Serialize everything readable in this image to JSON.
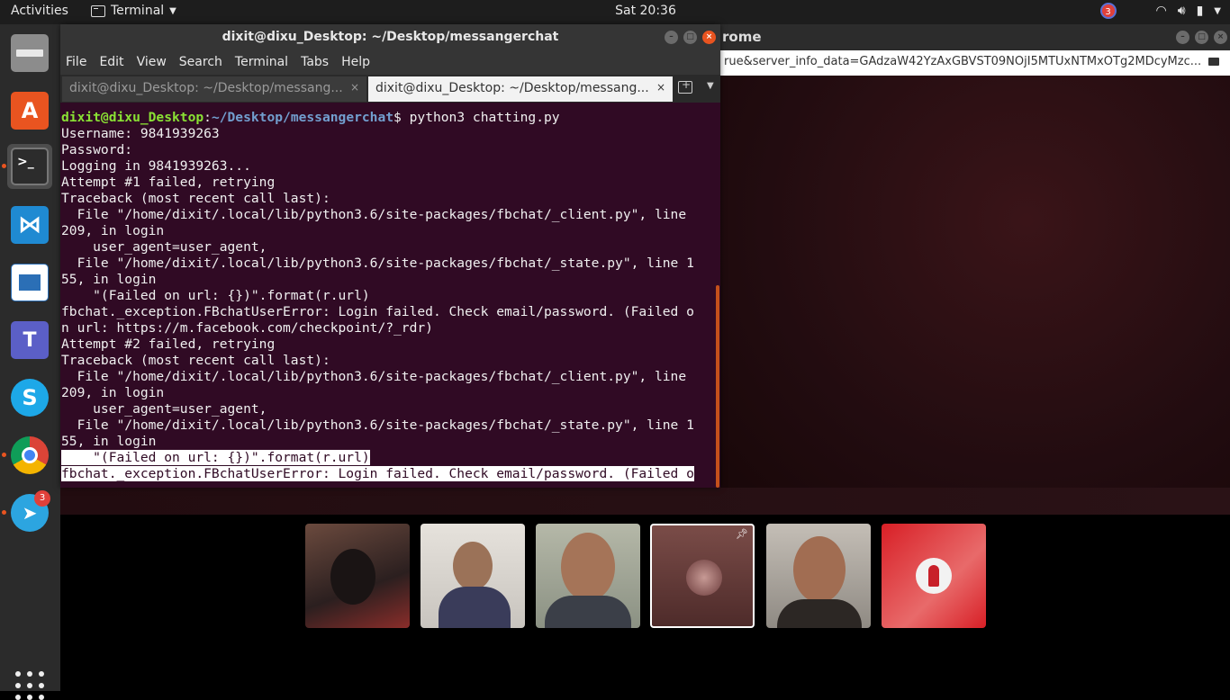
{
  "topbar": {
    "activities": "Activities",
    "app_name": "Terminal",
    "clock": "Sat 20:36",
    "notification_count": "3"
  },
  "dock": {
    "items": [
      {
        "name": "files",
        "color": "#8c8c8c"
      },
      {
        "name": "software",
        "color": "#e95420"
      },
      {
        "name": "terminal",
        "color": "#2c2c2c",
        "active": true
      },
      {
        "name": "vscode",
        "color": "#1f8ad2"
      },
      {
        "name": "writer",
        "color": "#2b6fb6"
      },
      {
        "name": "teams",
        "color": "#5b5fc7"
      },
      {
        "name": "skype",
        "color": "#1da8e8"
      },
      {
        "name": "chrome",
        "color": "#4285f4"
      },
      {
        "name": "telegram",
        "color": "#2ca5e0",
        "badge": "3"
      }
    ]
  },
  "chrome": {
    "title": "rome",
    "url": "rue&server_info_data=GAdzaW42YzAxGBVST09NOjI5MTUxNTMxOTg2MDcyMzc..."
  },
  "terminal": {
    "title": "dixit@dixu_Desktop: ~/Desktop/messangerchat",
    "menu": [
      "File",
      "Edit",
      "View",
      "Search",
      "Terminal",
      "Tabs",
      "Help"
    ],
    "tabs": [
      {
        "label": "dixit@dixu_Desktop: ~/Desktop/messang...",
        "close": "×"
      },
      {
        "label": "dixit@dixu_Desktop: ~/Desktop/messang...",
        "close": "×"
      }
    ],
    "prompt_user": "dixit@dixu_Desktop",
    "prompt_sep": ":",
    "prompt_path": "~/Desktop/messangerchat",
    "prompt_cmd": "$ python3 chatting.py",
    "lines": [
      "Username: 9841939263",
      "Password: ",
      "Logging in 9841939263...",
      "Attempt #1 failed, retrying",
      "Traceback (most recent call last):",
      "  File \"/home/dixit/.local/lib/python3.6/site-packages/fbchat/_client.py\", line",
      "209, in login",
      "    user_agent=user_agent,",
      "  File \"/home/dixit/.local/lib/python3.6/site-packages/fbchat/_state.py\", line 1",
      "55, in login",
      "    \"(Failed on url: {})\".format(r.url)",
      "fbchat._exception.FBchatUserError: Login failed. Check email/password. (Failed o",
      "n url: https://m.facebook.com/checkpoint/?_rdr)",
      "Attempt #2 failed, retrying",
      "Traceback (most recent call last):",
      "  File \"/home/dixit/.local/lib/python3.6/site-packages/fbchat/_client.py\", line",
      "209, in login",
      "    user_agent=user_agent,",
      "  File \"/home/dixit/.local/lib/python3.6/site-packages/fbchat/_state.py\", line 1",
      "55, in login"
    ],
    "selected_lines": [
      "    \"(Failed on url: {})\".format(r.url)",
      "fbchat._exception.FBchatUserError: Login failed. Check email/password. (Failed o"
    ]
  },
  "tiles": [
    {
      "name": "participant-1",
      "bg": "#3b2a2a"
    },
    {
      "name": "participant-2",
      "bg": "#d8d4cf"
    },
    {
      "name": "participant-3",
      "bg": "#9aa59a"
    },
    {
      "name": "participant-4",
      "bg": "#6a3f3c",
      "pinned": true
    },
    {
      "name": "participant-5",
      "bg": "#a7a19a"
    },
    {
      "name": "participant-6",
      "bg": "#d81f26"
    }
  ]
}
